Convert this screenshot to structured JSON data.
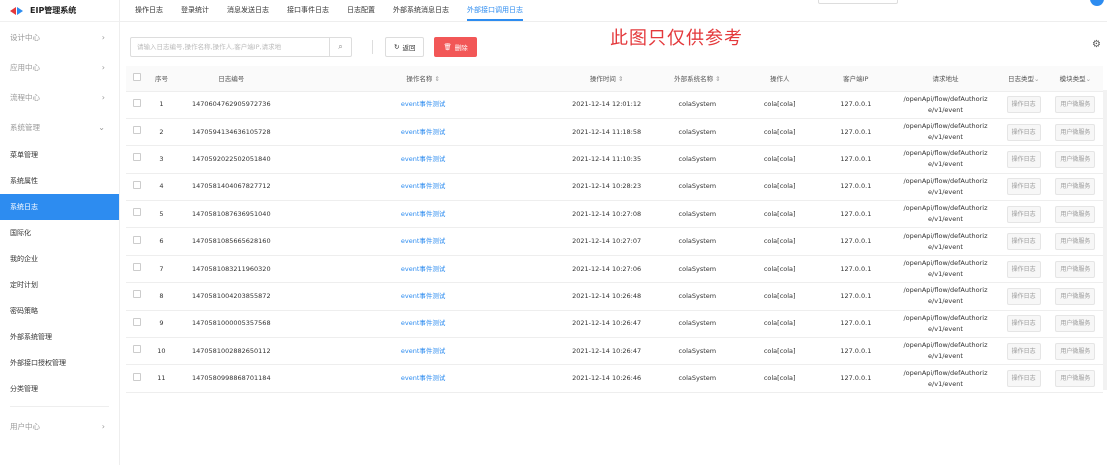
{
  "app": {
    "title": "EIP管理系统"
  },
  "sidebar": {
    "groups_top": [
      {
        "label": "设计中心"
      },
      {
        "label": "应用中心"
      },
      {
        "label": "流程中心"
      },
      {
        "label": "系统管理"
      }
    ],
    "items": [
      {
        "label": "菜单管理"
      },
      {
        "label": "系统属性"
      },
      {
        "label": "系统日志"
      },
      {
        "label": "国际化"
      },
      {
        "label": "我的企业"
      },
      {
        "label": "定时计划"
      },
      {
        "label": "密码策略"
      },
      {
        "label": "外部系统管理"
      },
      {
        "label": "外部接口授权管理"
      },
      {
        "label": "分类管理"
      }
    ],
    "groups_bottom": [
      {
        "label": "用户中心"
      }
    ]
  },
  "tabs": [
    {
      "label": "操作日志"
    },
    {
      "label": "登录统计"
    },
    {
      "label": "消息发送日志"
    },
    {
      "label": "接口事件日志"
    },
    {
      "label": "日志配置"
    },
    {
      "label": "外部系统消息日志"
    },
    {
      "label": "外部接口调用日志"
    }
  ],
  "watermark": "此图只仅供参考",
  "toolbar": {
    "search_placeholder": "请输入日志编号,操作名称,操作人,客户端IP,请求地",
    "return_label": "返回",
    "delete_label": "删除"
  },
  "table": {
    "headers": {
      "index": "序号",
      "log_id": "日志编号",
      "op_name": "操作名称",
      "op_time": "操作时间",
      "ext_name": "外部系统名称",
      "operator": "操作人",
      "client_ip": "客户端IP",
      "request_url": "请求地址",
      "log_type": "日志类型",
      "module_type": "模块类型"
    },
    "rows": [
      {
        "index": "1",
        "log_id": "1470604762905972736",
        "op_name": "event事件测试",
        "op_time": "2021-12-14 12:01:12",
        "ext_name": "colaSystem",
        "operator": "cola[cola]",
        "client_ip": "127.0.0.1",
        "url1": "/openApi/flow/defAuthoriz",
        "url2": "e/v1/event",
        "log_type": "操作日志",
        "module_type": "用户微服务"
      },
      {
        "index": "2",
        "log_id": "1470594134636105728",
        "op_name": "event事件测试",
        "op_time": "2021-12-14 11:18:58",
        "ext_name": "colaSystem",
        "operator": "cola[cola]",
        "client_ip": "127.0.0.1",
        "url1": "/openApi/flow/defAuthoriz",
        "url2": "e/v1/event",
        "log_type": "操作日志",
        "module_type": "用户微服务"
      },
      {
        "index": "3",
        "log_id": "1470592022502051840",
        "op_name": "event事件测试",
        "op_time": "2021-12-14 11:10:35",
        "ext_name": "colaSystem",
        "operator": "cola[cola]",
        "client_ip": "127.0.0.1",
        "url1": "/openApi/flow/defAuthoriz",
        "url2": "e/v1/event",
        "log_type": "操作日志",
        "module_type": "用户微服务"
      },
      {
        "index": "4",
        "log_id": "1470581404067827712",
        "op_name": "event事件测试",
        "op_time": "2021-12-14 10:28:23",
        "ext_name": "colaSystem",
        "operator": "cola[cola]",
        "client_ip": "127.0.0.1",
        "url1": "/openApi/flow/defAuthoriz",
        "url2": "e/v1/event",
        "log_type": "操作日志",
        "module_type": "用户微服务"
      },
      {
        "index": "5",
        "log_id": "1470581087636951040",
        "op_name": "event事件测试",
        "op_time": "2021-12-14 10:27:08",
        "ext_name": "colaSystem",
        "operator": "cola[cola]",
        "client_ip": "127.0.0.1",
        "url1": "/openApi/flow/defAuthoriz",
        "url2": "e/v1/event",
        "log_type": "操作日志",
        "module_type": "用户微服务"
      },
      {
        "index": "6",
        "log_id": "1470581085665628160",
        "op_name": "event事件测试",
        "op_time": "2021-12-14 10:27:07",
        "ext_name": "colaSystem",
        "operator": "cola[cola]",
        "client_ip": "127.0.0.1",
        "url1": "/openApi/flow/defAuthoriz",
        "url2": "e/v1/event",
        "log_type": "操作日志",
        "module_type": "用户微服务"
      },
      {
        "index": "7",
        "log_id": "1470581083211960320",
        "op_name": "event事件测试",
        "op_time": "2021-12-14 10:27:06",
        "ext_name": "colaSystem",
        "operator": "cola[cola]",
        "client_ip": "127.0.0.1",
        "url1": "/openApi/flow/defAuthoriz",
        "url2": "e/v1/event",
        "log_type": "操作日志",
        "module_type": "用户微服务"
      },
      {
        "index": "8",
        "log_id": "1470581004203855872",
        "op_name": "event事件测试",
        "op_time": "2021-12-14 10:26:48",
        "ext_name": "colaSystem",
        "operator": "cola[cola]",
        "client_ip": "127.0.0.1",
        "url1": "/openApi/flow/defAuthoriz",
        "url2": "e/v1/event",
        "log_type": "操作日志",
        "module_type": "用户微服务"
      },
      {
        "index": "9",
        "log_id": "1470581000005357568",
        "op_name": "event事件测试",
        "op_time": "2021-12-14 10:26:47",
        "ext_name": "colaSystem",
        "operator": "cola[cola]",
        "client_ip": "127.0.0.1",
        "url1": "/openApi/flow/defAuthoriz",
        "url2": "e/v1/event",
        "log_type": "操作日志",
        "module_type": "用户微服务"
      },
      {
        "index": "10",
        "log_id": "1470581002882650112",
        "op_name": "event事件测试",
        "op_time": "2021-12-14 10:26:47",
        "ext_name": "colaSystem",
        "operator": "cola[cola]",
        "client_ip": "127.0.0.1",
        "url1": "/openApi/flow/defAuthoriz",
        "url2": "e/v1/event",
        "log_type": "操作日志",
        "module_type": "用户微服务"
      },
      {
        "index": "11",
        "log_id": "1470580998868701184",
        "op_name": "event事件测试",
        "op_time": "2021-12-14 10:26:46",
        "ext_name": "colaSystem",
        "operator": "cola[cola]",
        "client_ip": "127.0.0.1",
        "url1": "/openApi/flow/defAuthoriz",
        "url2": "e/v1/event",
        "log_type": "操作日志",
        "module_type": "用户微服务"
      }
    ]
  }
}
